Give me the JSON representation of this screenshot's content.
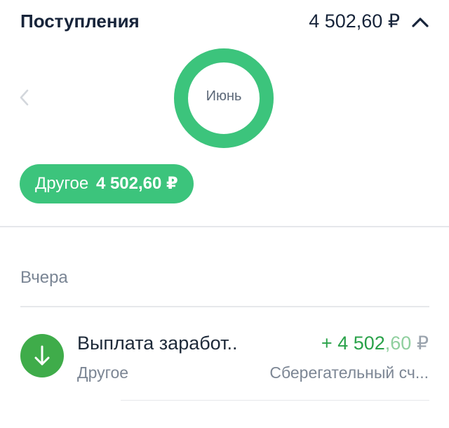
{
  "header": {
    "title": "Поступления",
    "total": "4 502,60 ₽",
    "collapse_icon": "chevron-up-icon"
  },
  "month": {
    "label": "Июнь",
    "prev_icon": "chevron-left-icon",
    "ring_color": "#3cc47c",
    "share": 1.0
  },
  "category_chip": {
    "label": "Другое",
    "amount": "4 502,60 ₽",
    "color": "#3cc47c"
  },
  "section": {
    "label": "Вчера"
  },
  "transactions": [
    {
      "title": "Выплата заработ..",
      "category": "Другое",
      "amount_main": "+ 4 502",
      "amount_frac": ",60",
      "amount_currency": " ₽",
      "account": "Сберегательный сч...",
      "icon": "arrow-down-icon",
      "icon_color": "#3fac4a"
    }
  ]
}
